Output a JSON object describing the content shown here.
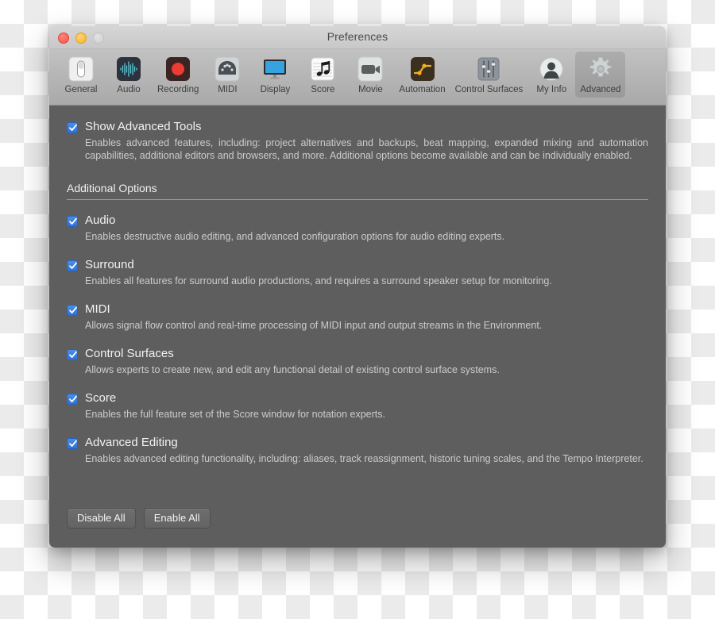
{
  "window": {
    "title": "Preferences",
    "traffic_lights": [
      {
        "name": "close",
        "color": "#f5564c"
      },
      {
        "name": "minimize",
        "color": "#f8b62b"
      },
      {
        "name": "zoom",
        "color": "#cfcfcf"
      }
    ]
  },
  "toolbar": {
    "selected": "Advanced",
    "tabs": [
      {
        "label": "General",
        "icon": "switch-icon"
      },
      {
        "label": "Audio",
        "icon": "waveform-icon"
      },
      {
        "label": "Recording",
        "icon": "record-icon"
      },
      {
        "label": "MIDI",
        "icon": "midi-connector-icon"
      },
      {
        "label": "Display",
        "icon": "monitor-icon"
      },
      {
        "label": "Score",
        "icon": "music-note-icon"
      },
      {
        "label": "Movie",
        "icon": "video-camera-icon"
      },
      {
        "label": "Automation",
        "icon": "automation-curve-icon"
      },
      {
        "label": "Control Surfaces",
        "icon": "faders-icon"
      },
      {
        "label": "My Info",
        "icon": "user-icon"
      },
      {
        "label": "Advanced",
        "icon": "gear-icon"
      }
    ]
  },
  "main": {
    "show_advanced_tools": {
      "label": "Show Advanced Tools",
      "checked": true,
      "description": "Enables advanced features, including: project alternatives and backups, beat mapping, expanded mixing and automation capabilities, additional editors and browsers, and more. Additional options become available and can be individually enabled."
    },
    "section_title": "Additional Options",
    "options": [
      {
        "label": "Audio",
        "checked": true,
        "description": "Enables destructive audio editing, and advanced configuration options for audio editing experts."
      },
      {
        "label": "Surround",
        "checked": true,
        "description": "Enables all features for surround audio productions, and requires a surround speaker setup for monitoring."
      },
      {
        "label": "MIDI",
        "checked": true,
        "description": "Allows signal flow control and real-time processing of MIDI input and output streams in the Environment."
      },
      {
        "label": "Control Surfaces",
        "checked": true,
        "description": "Allows experts to create new, and edit any functional detail of existing control surface systems."
      },
      {
        "label": "Score",
        "checked": true,
        "description": "Enables the full feature set of the Score window for notation experts."
      },
      {
        "label": "Advanced Editing",
        "checked": true,
        "description": "Enables advanced editing functionality, including: aliases, track reassignment, historic tuning scales, and the Tempo Interpreter."
      }
    ],
    "buttons": {
      "disable_all": "Disable All",
      "enable_all": "Enable All"
    }
  },
  "colors": {
    "checkbox_blue": "#2f72d8",
    "content_bg": "#5e5e5e",
    "toolbar_bg": "#b4b4b4"
  }
}
